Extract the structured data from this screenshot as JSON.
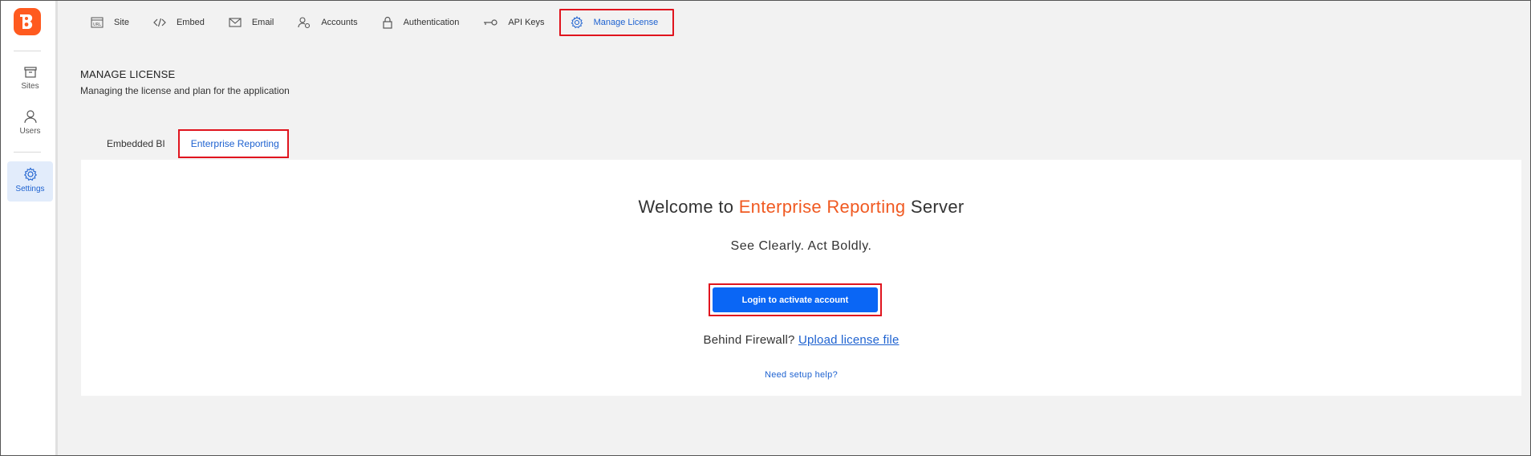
{
  "sidebar": {
    "logo_letter": "B",
    "items": [
      {
        "label": "Sites",
        "icon": "sites-icon"
      },
      {
        "label": "Users",
        "icon": "users-icon"
      },
      {
        "label": "Settings",
        "icon": "gear-icon"
      }
    ]
  },
  "topnav": {
    "items": [
      {
        "label": "Site",
        "icon": "url-icon"
      },
      {
        "label": "Embed",
        "icon": "code-icon"
      },
      {
        "label": "Email",
        "icon": "mail-icon"
      },
      {
        "label": "Accounts",
        "icon": "account-settings-icon"
      },
      {
        "label": "Authentication",
        "icon": "lock-icon"
      },
      {
        "label": "API Keys",
        "icon": "key-icon"
      },
      {
        "label": "Manage License",
        "icon": "license-gear-icon"
      }
    ],
    "active": "Manage License"
  },
  "header": {
    "title": "MANAGE LICENSE",
    "subtitle": "Managing the license and plan for the application"
  },
  "tabs": [
    {
      "label": "Embedded BI"
    },
    {
      "label": "Enterprise Reporting"
    }
  ],
  "card": {
    "welcome_prefix": "Welcome to ",
    "welcome_brand": "Enterprise Reporting",
    "welcome_suffix": " Server",
    "tagline": "See Clearly. Act Boldly.",
    "login_button": "Login to activate account",
    "firewall_text": "Behind Firewall? ",
    "upload_link": "Upload license file",
    "help_link": "Need setup help?"
  },
  "colors": {
    "brand_orange": "#f05a22",
    "accent_blue": "#0a66f5",
    "highlight_red": "#e0141e"
  }
}
